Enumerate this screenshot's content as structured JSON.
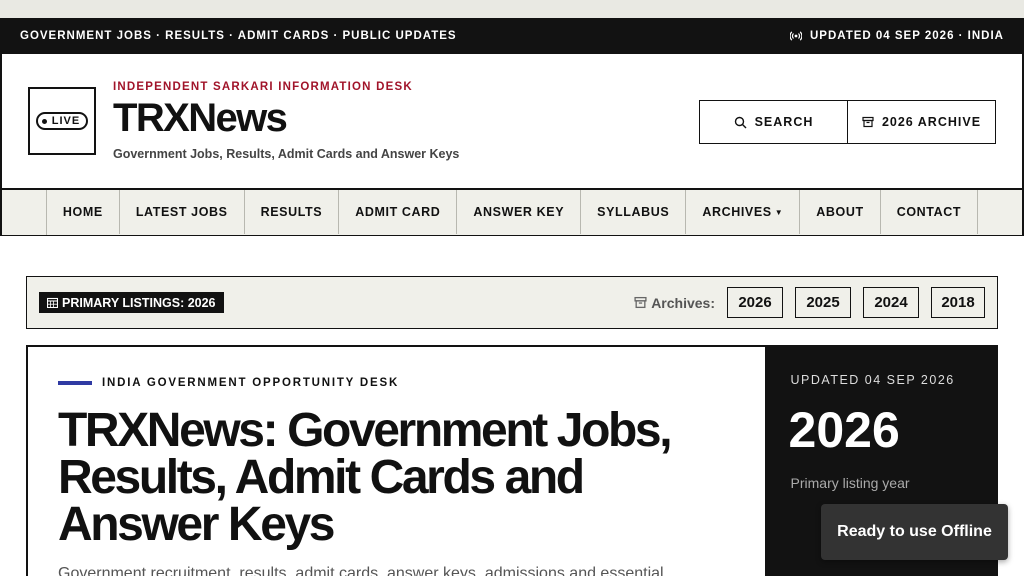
{
  "ticker": {
    "left_text": "GOVERNMENT JOBS · RESULTS · ADMIT CARDS · PUBLIC UPDATES",
    "right_text": "UPDATED 04 SEP 2026 · INDIA",
    "right_icon": "broadcast-icon"
  },
  "brand": {
    "live_label": "LIVE",
    "kicker": "INDEPENDENT SARKARI INFORMATION DESK",
    "title": "TRXNews",
    "tagline": "Government Jobs, Results, Admit Cards and Answer Keys"
  },
  "actions": {
    "search_label": "SEARCH",
    "search_icon": "search-icon",
    "archive_label": "2026 ARCHIVE",
    "archive_icon": "archive-box-icon"
  },
  "nav": {
    "items": [
      {
        "label": "HOME"
      },
      {
        "label": "LATEST JOBS"
      },
      {
        "label": "RESULTS"
      },
      {
        "label": "ADMIT CARD"
      },
      {
        "label": "ANSWER KEY"
      },
      {
        "label": "SYLLABUS"
      },
      {
        "label": "ARCHIVES"
      },
      {
        "label": "ABOUT"
      },
      {
        "label": "CONTACT"
      }
    ]
  },
  "listings": {
    "primary_label": "PRIMARY LISTINGS: 2026",
    "primary_icon": "calendar-icon",
    "archives_label": "Archives:",
    "archives_icon": "archive-box-icon",
    "years": [
      "2026",
      "2025",
      "2024",
      "2018"
    ]
  },
  "hero": {
    "desk_label": "INDIA GOVERNMENT OPPORTUNITY DESK",
    "title": "TRXNews: Government Jobs, Results, Admit Cards and Answer Keys",
    "description": "Government recruitment, results, admit cards, answer keys, admissions and essential",
    "accent": "#2f3aa3"
  },
  "side": {
    "updated": "UPDATED 04 SEP 2026",
    "year": "2026",
    "caption": "Primary listing year"
  },
  "toast": {
    "text": "Ready to use Offline"
  },
  "colors": {
    "ink": "#121212",
    "kicker_red": "#a1142a",
    "panel": "#f0f0ea"
  }
}
